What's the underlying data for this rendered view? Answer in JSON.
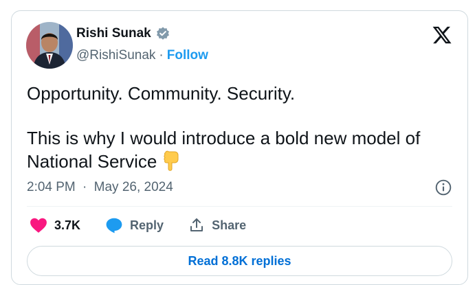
{
  "author": {
    "name": "Rishi Sunak",
    "handle": "@RishiSunak",
    "separator": "·",
    "follow_label": "Follow",
    "avatar_icon": "person-portrait-avatar",
    "verified_icon": "verified-badge-icon"
  },
  "tweet": {
    "line1": "Opportunity. Community. Security.",
    "line2": "This is why I would introduce a bold new model of National Service",
    "emoji": "👇",
    "time": "2:04 PM",
    "date_separator": "·",
    "date": "May 26, 2024"
  },
  "actions": {
    "likes_count": "3.7K",
    "reply_label": "Reply",
    "share_label": "Share"
  },
  "read_replies_label": "Read 8.8K replies",
  "colors": {
    "accent": "#1d9bf0",
    "link": "#006fd6",
    "like": "#f91880",
    "muted": "#536471",
    "border": "#cfd9de"
  }
}
